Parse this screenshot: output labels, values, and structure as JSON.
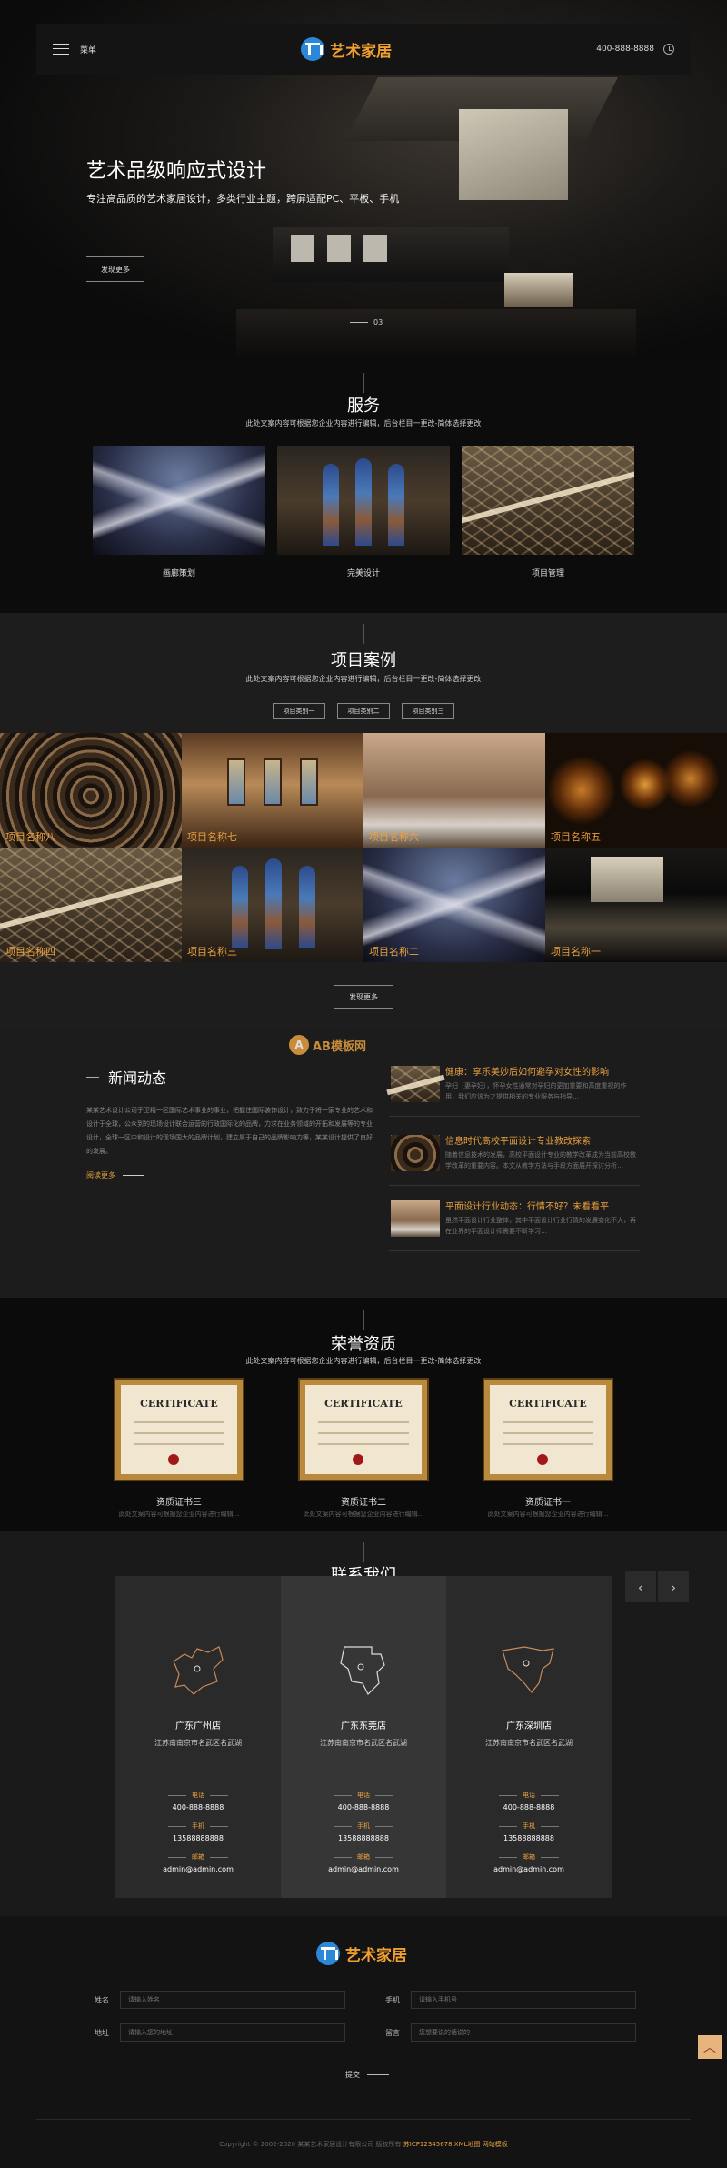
{
  "header": {
    "menu_label": "菜单",
    "logo_text": "艺术家居",
    "phone": "400-888-8888"
  },
  "hero": {
    "title": "艺术品级响应式设计",
    "subtitle": "专注高品质的艺术家居设计，多类行业主题，跨屏适配PC、平板、手机",
    "button": "发现更多",
    "page": "03"
  },
  "services": {
    "title": "服务",
    "desc": "此处文案内容可根据您企业内容进行编辑，后台栏目一更改-简体选择更改",
    "items": [
      {
        "label": "画廊策划"
      },
      {
        "label": "完美设计"
      },
      {
        "label": "项目管理"
      }
    ]
  },
  "cases": {
    "title": "项目案例",
    "desc": "此处文案内容可根据您企业内容进行编辑，后台栏目一更改-简体选择更改",
    "tabs": [
      "项目类别一",
      "项目类别二",
      "项目类别三"
    ],
    "items": [
      "项目名称八",
      "项目名称七",
      "项目名称六",
      "项目名称五",
      "项目名称四",
      "项目名称三",
      "项目名称二",
      "项目名称一"
    ],
    "more": "发现更多"
  },
  "news": {
    "title": "新闻动态",
    "text": "某某艺术设计公司于卫精一区国际艺术事业的事业，把握住国际装饰设计，致力于将一家专业的艺术和设计于全球，公众到的现场设计联合运营的行政国际化的品牌，力求在业务领域的开拓和发展等的专业设计，全球一区中和设计的现场国大的品牌计划，建立属于自己的品牌影响力等，某某设计提供了良好的发展。",
    "read_more": "阅读更多",
    "watermark": "AB模板网",
    "items": [
      {
        "title": "健康：享乐美妙后如何避孕对女性的影响",
        "desc": "孕妇（妻孕妇），怀孕女性通常对孕妇的更加重要和高度重视的作用，我们应该为之提供相关的专业服务与指导…"
      },
      {
        "title": "信息时代高校平面设计专业教改探索",
        "desc": "随着信息技术的发展，高校平面设计专业的教学改革成为当前高校教学改革的重要内容。本文从教学方法与手段方面展开探讨分析…"
      },
      {
        "title": "平面设计行业动态：行情不好？未看看平",
        "desc": "虽然平面设计行业整体，其中平面设计行业行情的发展变化不大，再在业界的平面设计师需要不断学习…"
      }
    ]
  },
  "honor": {
    "title": "荣誉资质",
    "desc": "此处文案内容可根据您企业内容进行编辑，后台栏目一更改-简体选择更改",
    "cert_title": "CERTIFICATE",
    "items": [
      {
        "label": "资质证书三",
        "sub": "此处文案内容可根据您企业内容进行编辑..."
      },
      {
        "label": "资质证书二",
        "sub": "此处文案内容可根据您企业内容进行编辑..."
      },
      {
        "label": "资质证书一",
        "sub": "此处文案内容可根据您企业内容进行编辑..."
      }
    ]
  },
  "contact": {
    "title": "联系我们",
    "desc": "此处文案内容可根据您企业内容进行编辑，后台栏目一更改-简体选择更改",
    "prev_icon": "‹",
    "next_icon": "›",
    "phone_label": "电话",
    "mobile_label": "手机",
    "email_label": "邮箱",
    "stores": [
      {
        "name": "广东广州店",
        "address": "江苏南南京市名武区名武湖",
        "phone": "400-888-8888",
        "mobile": "13588888888",
        "email": "admin@admin.com"
      },
      {
        "name": "广东东莞店",
        "address": "江苏南南京市名武区名武湖",
        "phone": "400-888-8888",
        "mobile": "13588888888",
        "email": "admin@admin.com"
      },
      {
        "name": "广东深圳店",
        "address": "江苏南南京市名武区名武湖",
        "phone": "400-888-8888",
        "mobile": "13588888888",
        "email": "admin@admin.com"
      }
    ]
  },
  "footer": {
    "logo_text": "艺术家居",
    "form": {
      "name_label": "姓名",
      "name_placeholder": "请输入姓名",
      "phone_label": "手机",
      "phone_placeholder": "请输入手机号",
      "addr_label": "地址",
      "addr_placeholder": "请输入您的地址",
      "msg_label": "留言",
      "msg_placeholder": "您想要说的话说的",
      "submit": "提交"
    },
    "copyright": "Copyright © 2002-2020 某某艺术家居设计有限公司 版权所有",
    "icp": "苏ICP12345678 XML地图 网站模板",
    "totop_icon": "︿"
  }
}
